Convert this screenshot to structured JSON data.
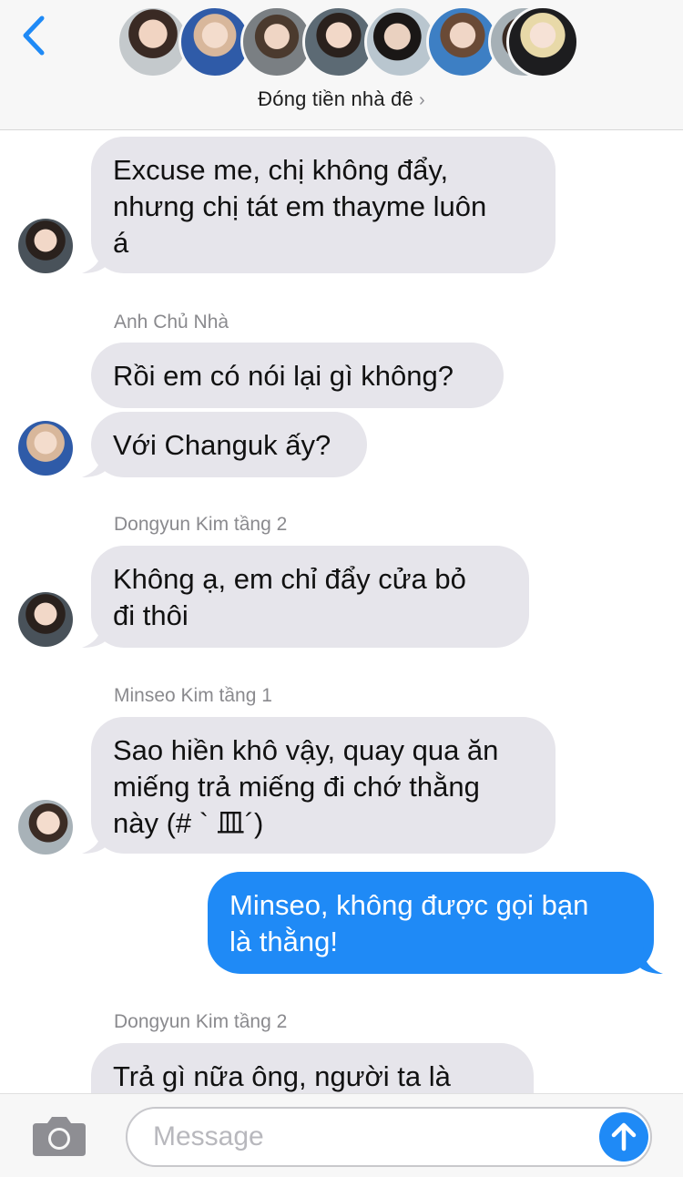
{
  "header": {
    "back_icon": "chevron-left-icon",
    "group_name": "Đóng tiền nhà đê",
    "group_chevron": "›",
    "member_avatars": [
      "member-1",
      "member-2",
      "member-3",
      "member-4",
      "member-5",
      "member-6",
      "member-7",
      "member-8"
    ]
  },
  "messages": [
    {
      "direction": "in",
      "sender": "",
      "text_lines": [
        "Excuse me, chị không đẩy,",
        "nhưng chị tát em thayme luôn",
        "á"
      ]
    },
    {
      "direction": "in",
      "sender": "Anh Chủ Nhà",
      "text_lines": [
        "Rồi em có nói lại gì không?"
      ]
    },
    {
      "direction": "in",
      "sender": "",
      "text_lines": [
        "Với Changuk ấy?"
      ]
    },
    {
      "direction": "in",
      "sender": "Dongyun Kim tầng 2",
      "text_lines": [
        "Không ạ, em chỉ đẩy cửa bỏ",
        "đi thôi"
      ]
    },
    {
      "direction": "in",
      "sender": "Minseo Kim tầng 1",
      "text_lines": [
        "Sao hiền khô vậy, quay qua ăn",
        "miếng trả miếng đi chớ thằng",
        "này (# ` 皿´)"
      ]
    },
    {
      "direction": "out",
      "sender": "",
      "text_lines": [
        "Minseo, không được gọi bạn",
        "là thằng!"
      ]
    },
    {
      "direction": "in",
      "sender": "Dongyun Kim tầng 2",
      "text_lines": [
        "Trả gì nữa ông, người ta là"
      ]
    }
  ],
  "composer": {
    "camera_icon": "camera-icon",
    "placeholder": "Message",
    "send_icon": "arrow-up-icon"
  },
  "colors": {
    "incoming_bubble": "#e6e5eb",
    "outgoing_bubble": "#1f8af6",
    "accent": "#1f8af6"
  }
}
